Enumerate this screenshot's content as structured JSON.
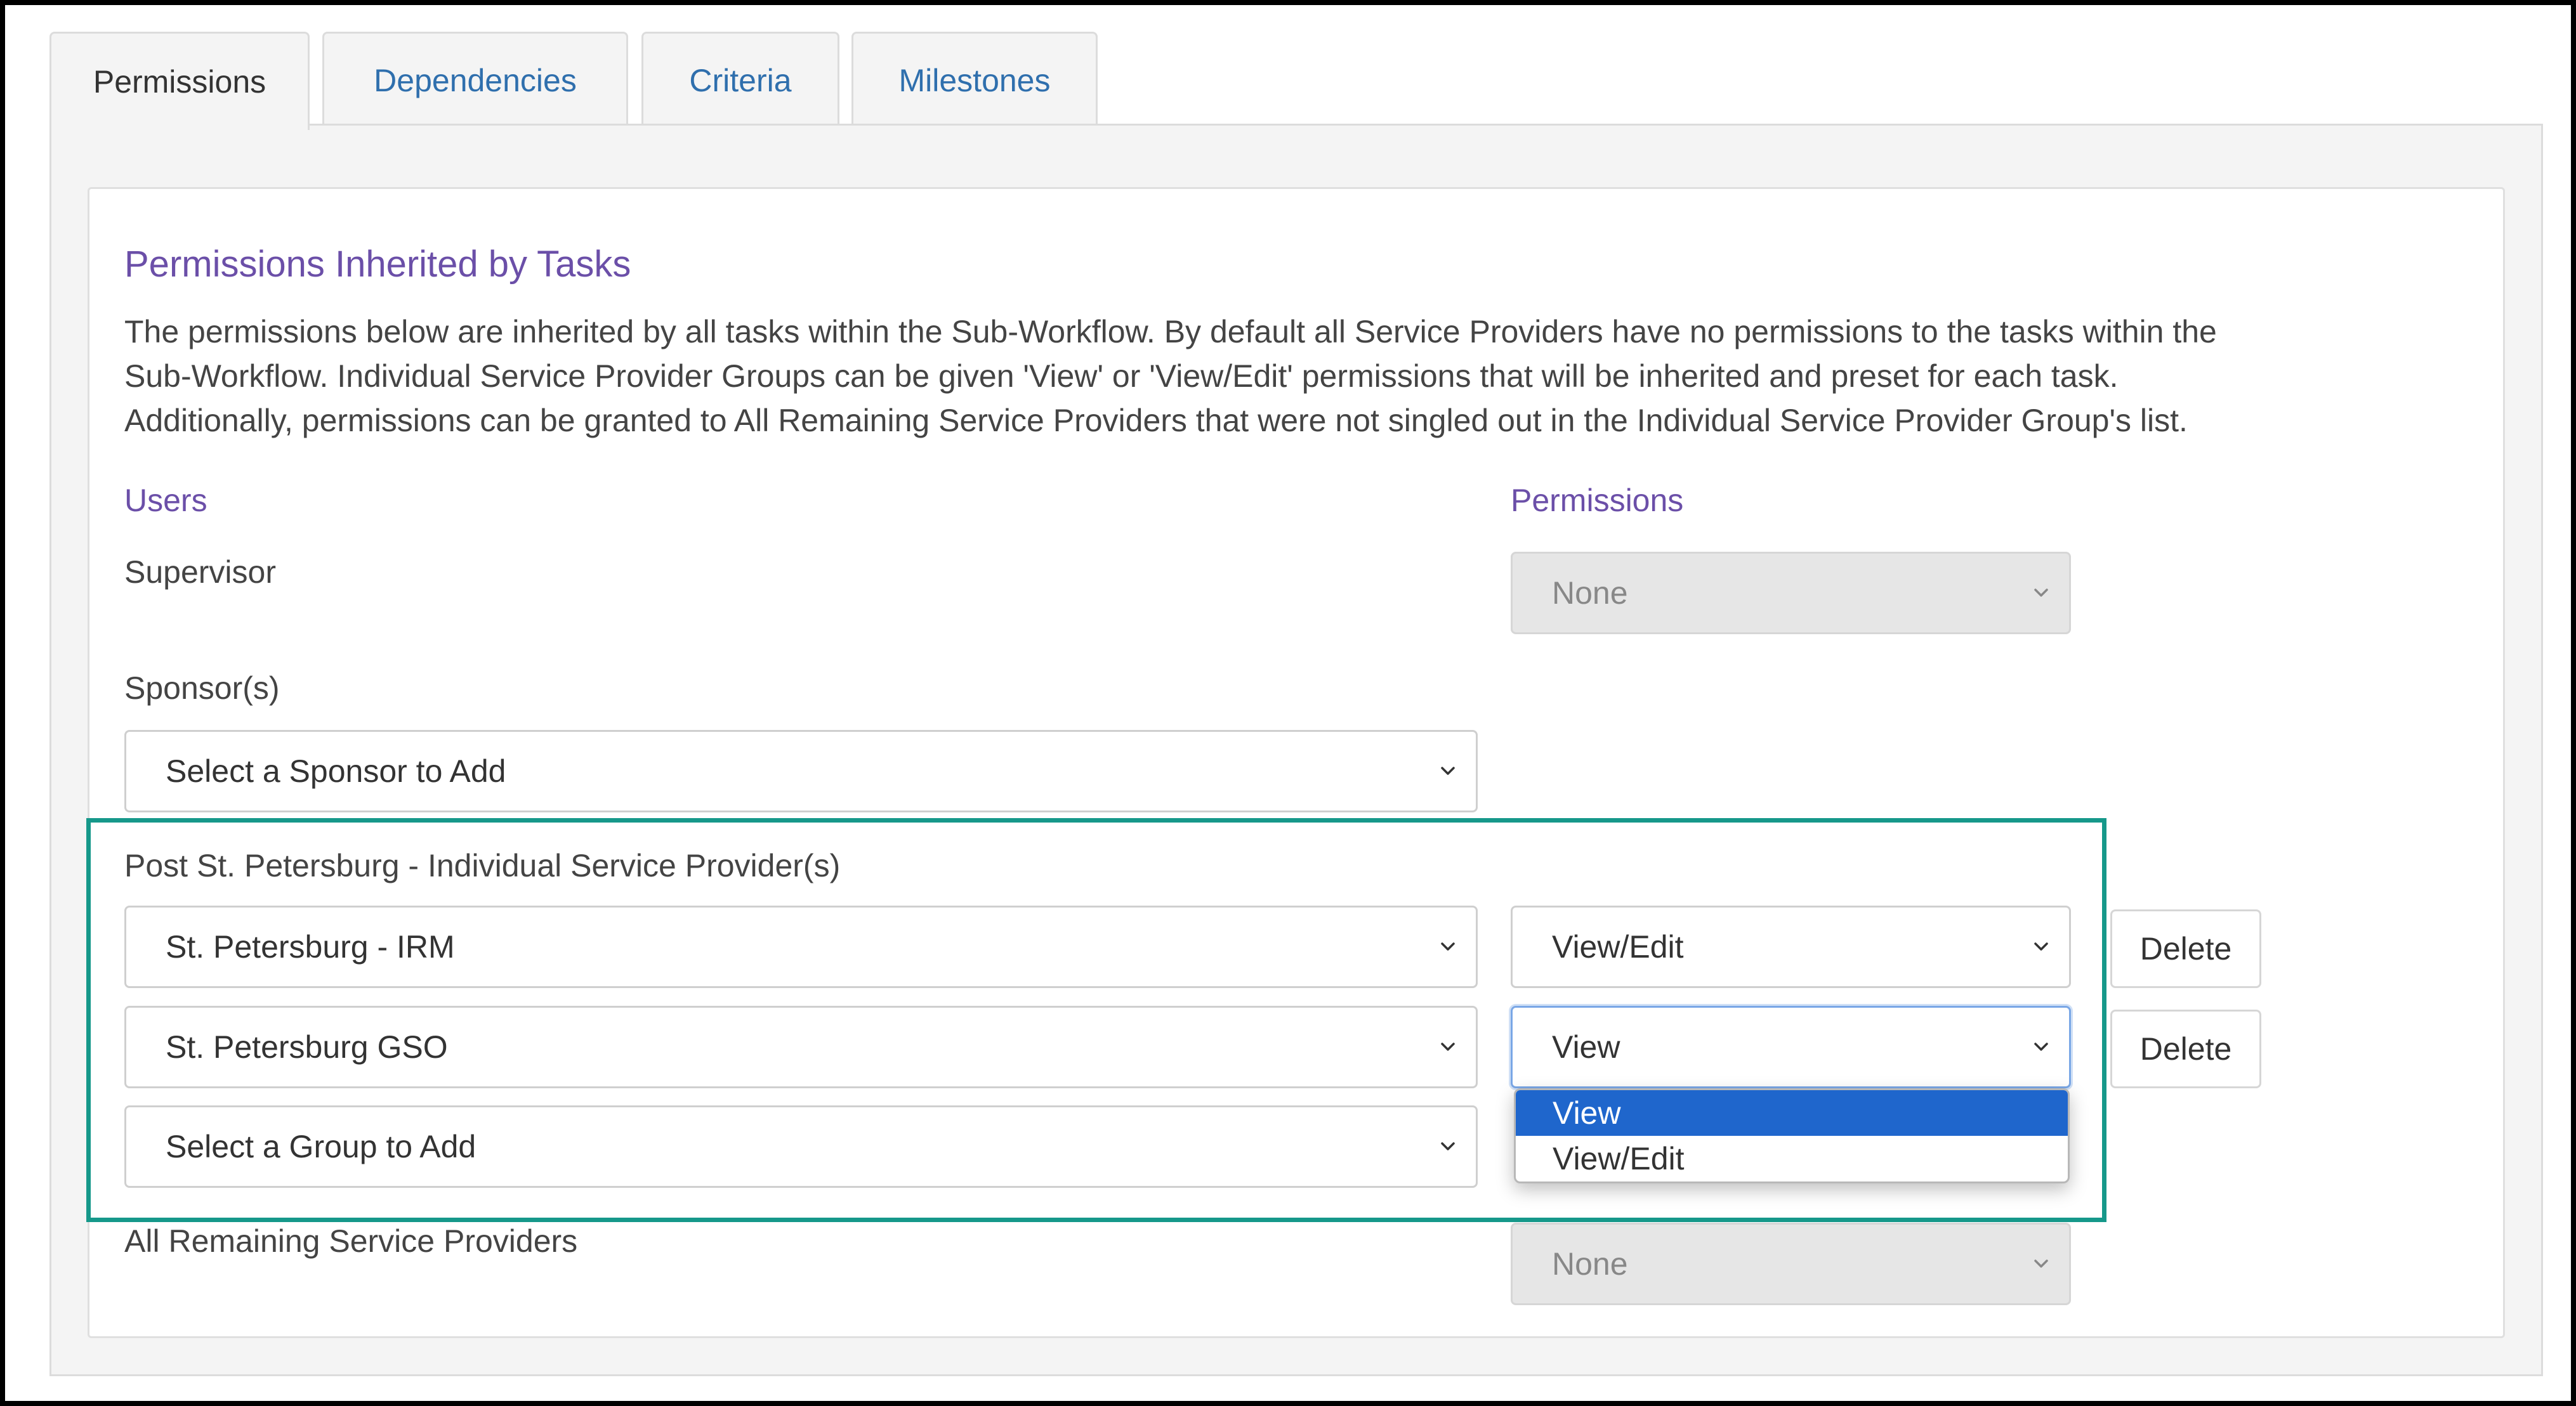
{
  "tabs": [
    {
      "label": "Permissions",
      "active": true
    },
    {
      "label": "Dependencies",
      "active": false
    },
    {
      "label": "Criteria",
      "active": false
    },
    {
      "label": "Milestones",
      "active": false
    }
  ],
  "section": {
    "title": "Permissions Inherited by Tasks",
    "description_lines": [
      "The permissions below are inherited by all tasks within the Sub-Workflow. By default all Service Providers have no permissions to the tasks within the",
      "Sub-Workflow. Individual Service Provider Groups can be given 'View' or 'View/Edit' permissions that will be inherited and preset for each task.",
      "Additionally, permissions can be granted to All Remaining Service Providers that were not singled out in the Individual Service Provider Group's list."
    ]
  },
  "columns": {
    "users": "Users",
    "permissions": "Permissions"
  },
  "supervisor": {
    "label": "Supervisor",
    "permission": "None"
  },
  "sponsors": {
    "label": "Sponsor(s)",
    "select_value": "Select a Sponsor to Add"
  },
  "providers": {
    "label": "Post St. Petersburg - Individual Service Provider(s)",
    "rows": [
      {
        "group": "St. Petersburg - IRM",
        "permission": "View/Edit",
        "delete_label": "Delete"
      },
      {
        "group": "St. Petersburg GSO",
        "permission": "View",
        "delete_label": "Delete"
      }
    ],
    "add_group_value": "Select a Group to Add"
  },
  "remaining": {
    "label": "All Remaining Service Providers",
    "permission": "None"
  },
  "permission_dropdown": {
    "options": [
      "View",
      "View/Edit"
    ],
    "selected": "View"
  },
  "colors": {
    "accent_purple": "#6b4fa8",
    "tab_link": "#2f6fad",
    "highlight_teal": "#16988a",
    "option_selected": "#1f66cc"
  }
}
